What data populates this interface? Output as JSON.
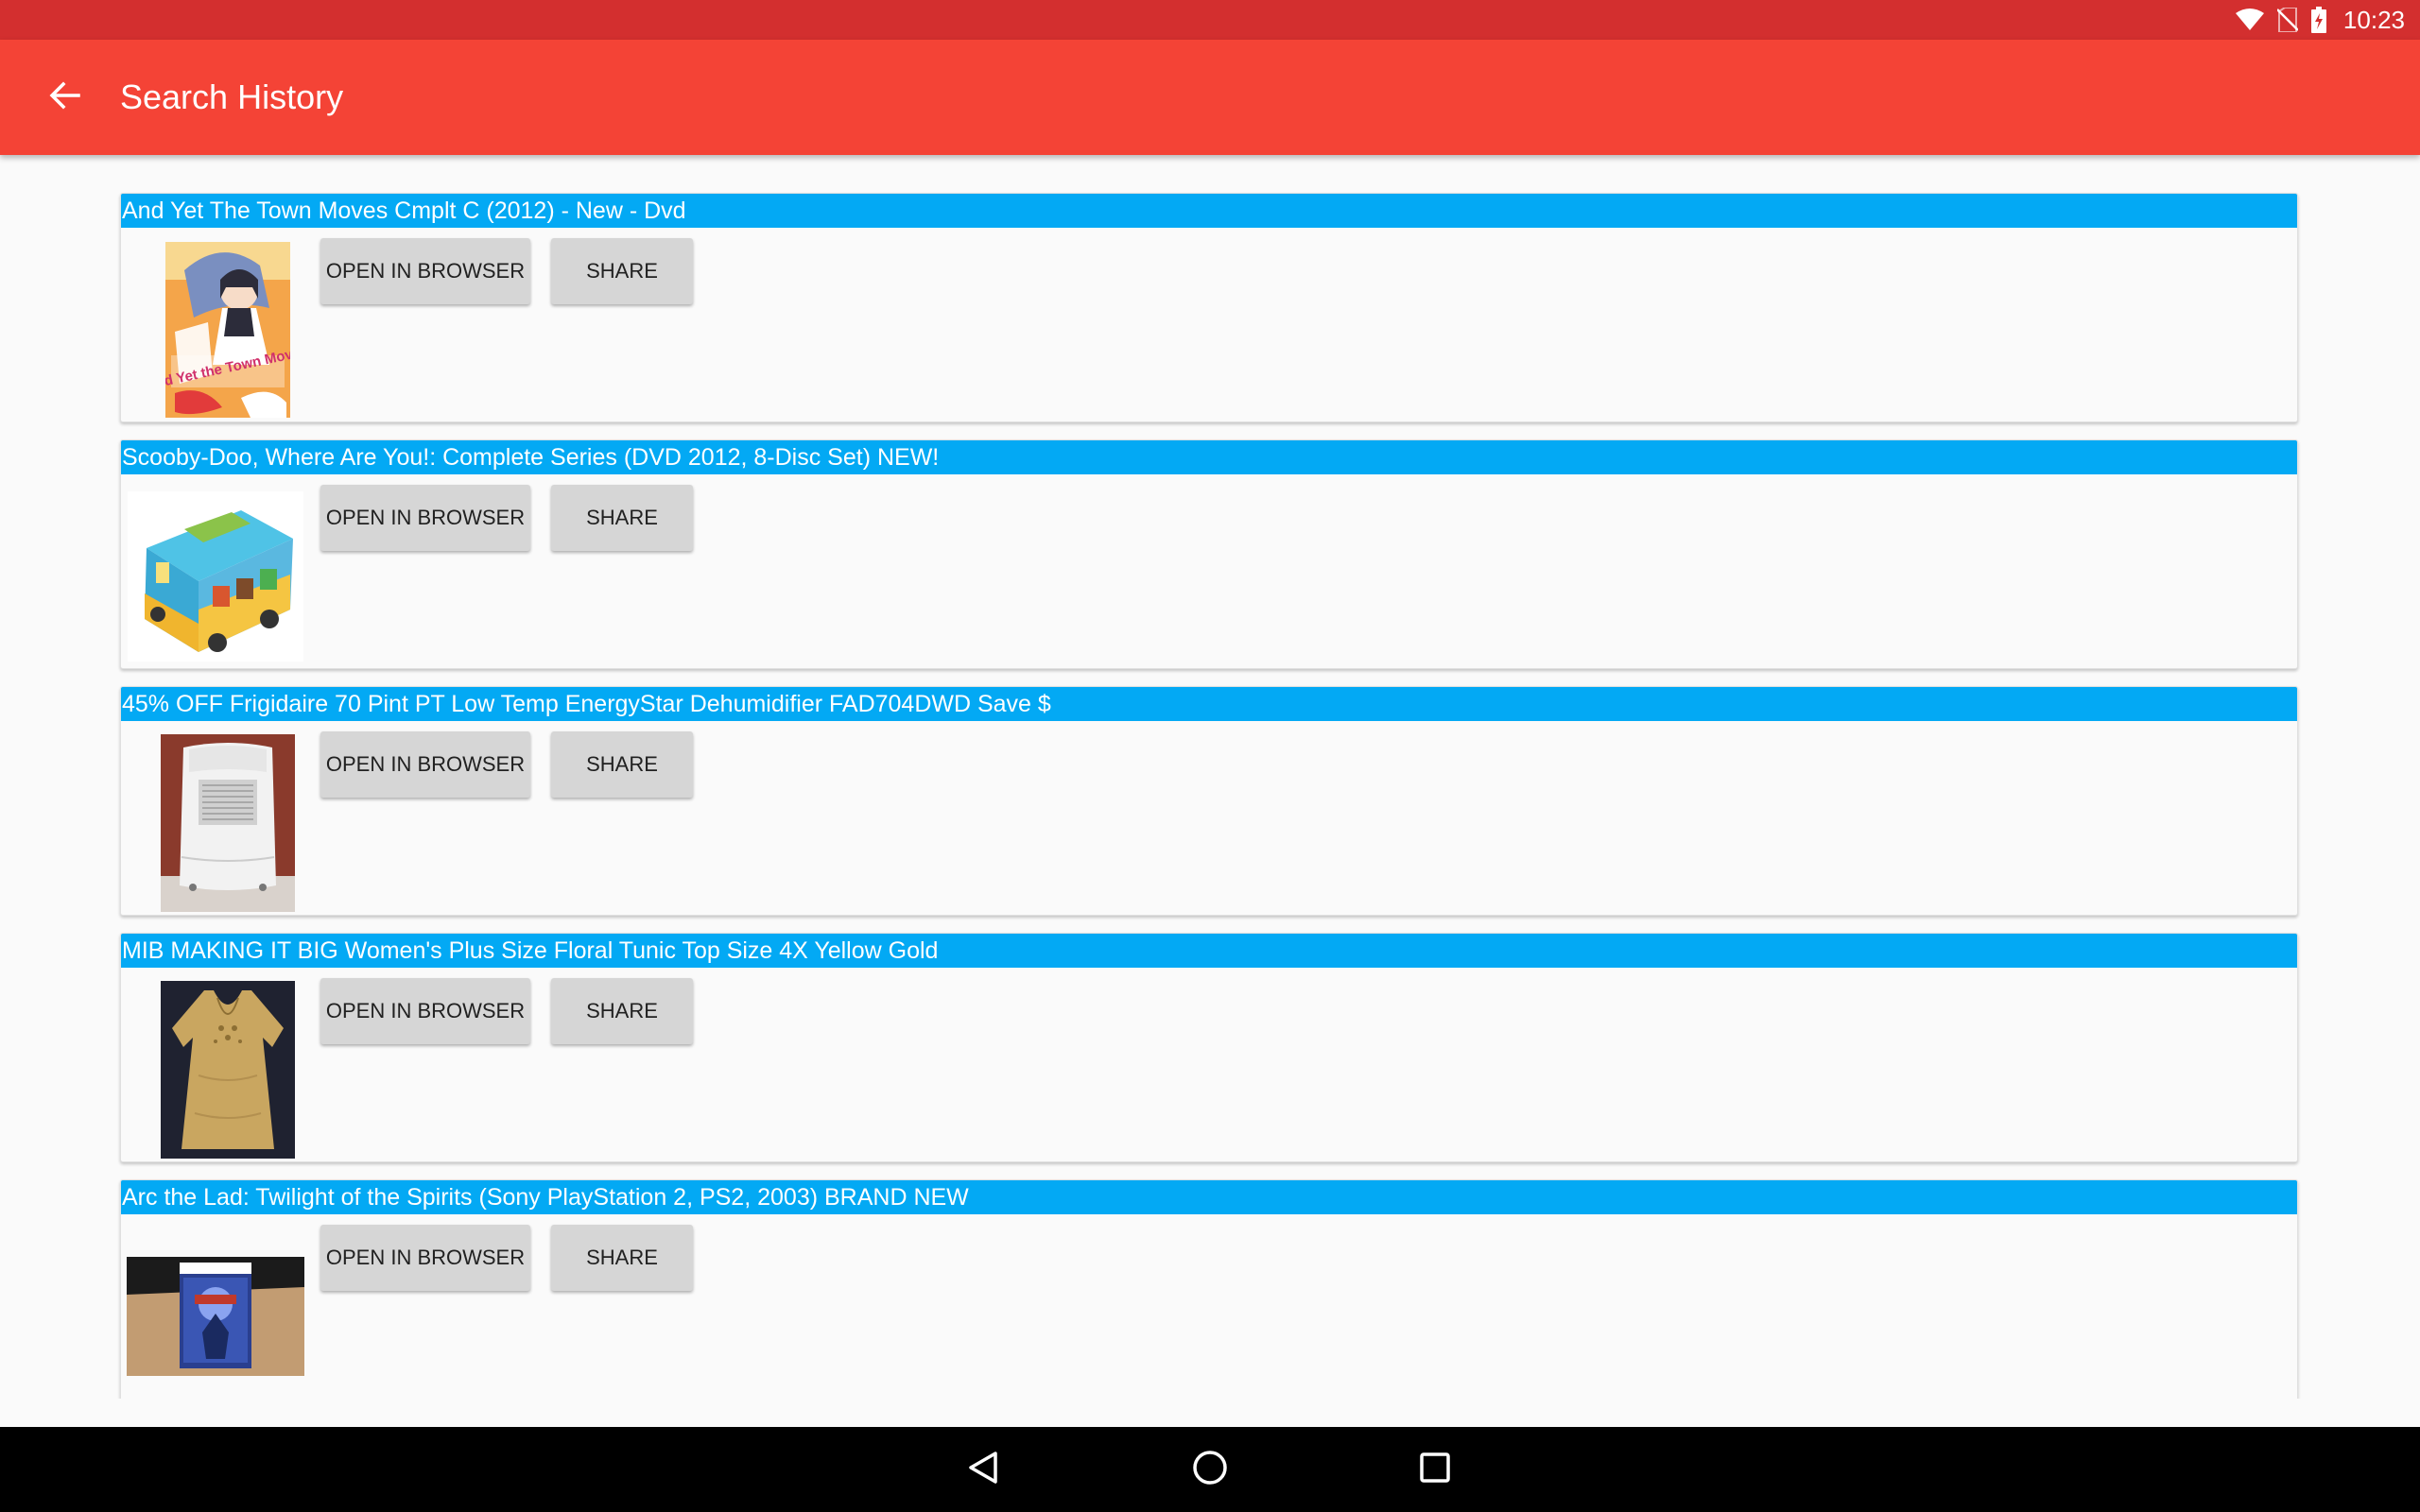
{
  "status_bar": {
    "time": "10:23",
    "icons": [
      "wifi-icon",
      "no-sim-icon",
      "battery-charging-icon"
    ]
  },
  "app_bar": {
    "title": "Search History",
    "back_icon": "arrow-back-icon"
  },
  "colors": {
    "status_bar": "#d32f2f",
    "app_bar": "#f44336",
    "card_title_bar": "#03a9f4",
    "button": "#d6d6d6",
    "background": "#fafafa",
    "nav_bar": "#000000"
  },
  "items": [
    {
      "title": "And Yet The Town Moves Cmplt C (2012) - New - Dvd",
      "thumb_icon": "dvd-cover-thumbnail",
      "thumb_text": "And Yet the Town Moves",
      "open_label": "OPEN IN BROWSER",
      "share_label": "SHARE"
    },
    {
      "title": "Scooby-Doo, Where Are You!: Complete Series (DVD 2012, 8-Disc Set) NEW!",
      "thumb_icon": "dvd-box-set-thumbnail",
      "open_label": "OPEN IN BROWSER",
      "share_label": "SHARE"
    },
    {
      "title": "45% OFF Frigidaire 70 Pint PT Low Temp EnergyStar  Dehumidifier FAD704DWD Save $",
      "thumb_icon": "dehumidifier-thumbnail",
      "open_label": "OPEN IN BROWSER",
      "share_label": "SHARE"
    },
    {
      "title": "MIB MAKING IT BIG Women's Plus Size Floral Tunic Top Size 4X Yellow Gold",
      "thumb_icon": "tunic-top-thumbnail",
      "open_label": "OPEN IN BROWSER",
      "share_label": "SHARE"
    },
    {
      "title": "Arc the Lad: Twilight of the Spirits (Sony PlayStation 2, PS2, 2003) BRAND NEW",
      "thumb_icon": "game-case-thumbnail",
      "open_label": "OPEN IN BROWSER",
      "share_label": "SHARE"
    }
  ],
  "nav_bar": {
    "icons": [
      "nav-back-icon",
      "nav-home-icon",
      "nav-recents-icon"
    ]
  }
}
